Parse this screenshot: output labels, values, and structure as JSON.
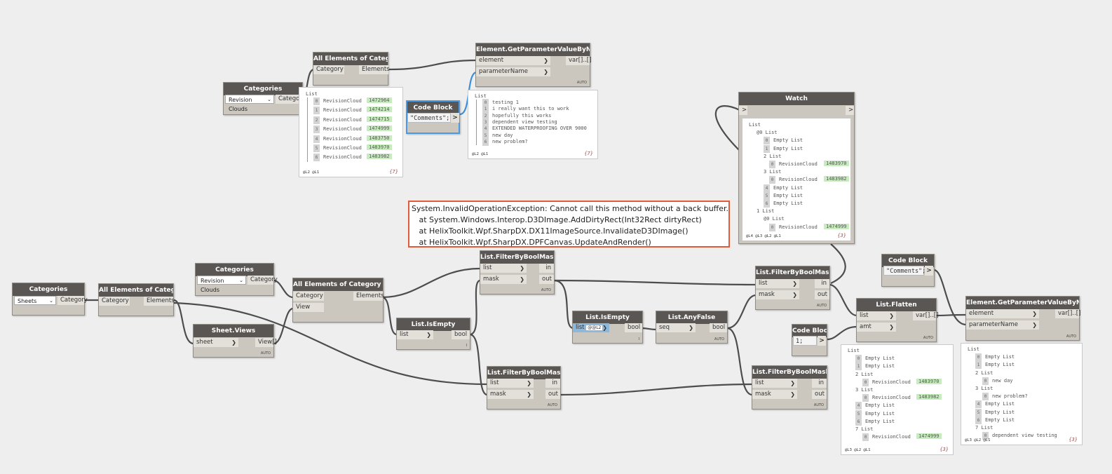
{
  "nodes": {
    "cat_top": {
      "title": "Categories",
      "dropdown": "Revision Clouds",
      "out": "Category"
    },
    "aeoc_top": {
      "title": "All Elements of Category",
      "in": "Category",
      "out": "Elements"
    },
    "codeblock_top": {
      "title": "Code Block",
      "code": "\"Comments\";",
      "arrow": ">"
    },
    "getparam_top": {
      "title": "Element.GetParameterValueByName",
      "in1": "element",
      "in2": "parameterName",
      "out": "var[]..[]",
      "lacing": "AUTO"
    },
    "watch": {
      "title": "Watch",
      "in": ">",
      "out": ">"
    },
    "cat_left": {
      "title": "Categories",
      "dropdown": "Sheets",
      "out": "Category"
    },
    "aeoc_left": {
      "title": "All Elements of Category",
      "in": "Category",
      "out": "Elements"
    },
    "cat_mid": {
      "title": "Categories",
      "dropdown": "Revision Clouds",
      "out": "Category"
    },
    "sheetviews": {
      "title": "Sheet.Views",
      "in": "sheet",
      "out": "View[]",
      "lacing": "AUTO"
    },
    "aeociv": {
      "title": "All Elements of Category in View",
      "in1": "Category",
      "in2": "View",
      "out": "Elements"
    },
    "filter1": {
      "title": "List.FilterByBoolMask",
      "in1": "list",
      "in2": "mask",
      "out1": "in",
      "out2": "out",
      "lacing": "AUTO"
    },
    "isempty1": {
      "title": "List.IsEmpty",
      "in": "list",
      "out": "bool",
      "lacing": "I"
    },
    "filter2": {
      "title": "List.FilterByBoolMask",
      "in1": "list",
      "in2": "mask",
      "out1": "in",
      "out2": "out",
      "lacing": "AUTO"
    },
    "isempty2": {
      "title": "List.IsEmpty",
      "in": "list",
      "use_levels": "@@L2",
      "out": "bool",
      "lacing": "I"
    },
    "anyfalse": {
      "title": "List.AnyFalse",
      "in": "seq",
      "out": "bool",
      "lacing": "AUTO"
    },
    "filter3": {
      "title": "List.FilterByBoolMask",
      "in1": "list",
      "in2": "mask",
      "out1": "in",
      "out2": "out",
      "lacing": "AUTO"
    },
    "filter4": {
      "title": "List.FilterByBoolMask",
      "in1": "list",
      "in2": "mask",
      "out1": "in",
      "out2": "out",
      "lacing": "AUTO"
    },
    "codeblock_r": {
      "title": "Code Block",
      "code": "\"Comments\";",
      "arrow": ">"
    },
    "codeblock_1": {
      "title": "Code Block",
      "code": "1;",
      "arrow": ">"
    },
    "flatten": {
      "title": "List.Flatten",
      "in1": "list",
      "in2": "amt",
      "out": "var[]..[]",
      "lacing": "AUTO"
    },
    "getparam_r": {
      "title": "Element.GetParameterValueByName",
      "in1": "element",
      "in2": "parameterName",
      "out": "var[]..[]",
      "lacing": "AUTO"
    }
  },
  "previews": {
    "aeoc_top": {
      "header": "List",
      "items": [
        {
          "i": "0",
          "label": "RevisionCloud",
          "value": "1472964"
        },
        {
          "i": "1",
          "label": "RevisionCloud",
          "value": "1474214"
        },
        {
          "i": "2",
          "label": "RevisionCloud",
          "value": "1474715"
        },
        {
          "i": "3",
          "label": "RevisionCloud",
          "value": "1474999"
        },
        {
          "i": "4",
          "label": "RevisionCloud",
          "value": "1483750"
        },
        {
          "i": "5",
          "label": "RevisionCloud",
          "value": "1483970"
        },
        {
          "i": "6",
          "label": "RevisionCloud",
          "value": "1483982"
        }
      ],
      "levels": "@L2 @L1",
      "count": "{7}"
    },
    "getparam_top": {
      "header": "List",
      "items": [
        {
          "i": "0",
          "text": "testing 1"
        },
        {
          "i": "1",
          "text": "i really want this to work"
        },
        {
          "i": "2",
          "text": "hopefully this works"
        },
        {
          "i": "3",
          "text": "dependent view testing"
        },
        {
          "i": "4",
          "text": "EXTENDED WATERPROOFING OVER 9000"
        },
        {
          "i": "5",
          "text": "new day"
        },
        {
          "i": "6",
          "text": "new problem?"
        }
      ],
      "levels": "@L2 @L1",
      "count": "{7}"
    },
    "watch": {
      "rows": [
        {
          "t": "List"
        },
        {
          "t": "@0 List"
        },
        {
          "i": "0",
          "t": "Empty List"
        },
        {
          "i": "1",
          "t": "Empty List"
        },
        {
          "t": "2 List"
        },
        {
          "i": "0",
          "t": "RevisionCloud",
          "v": "1483970"
        },
        {
          "t": "3 List"
        },
        {
          "i": "0",
          "t": "RevisionCloud",
          "v": "1483982"
        },
        {
          "i": "4",
          "t": "Empty List"
        },
        {
          "i": "5",
          "t": "Empty List"
        },
        {
          "i": "6",
          "t": "Empty List"
        },
        {
          "t": "1 List"
        },
        {
          "t": "@0 List"
        },
        {
          "i": "0",
          "t": "RevisionCloud",
          "v": "1474999"
        }
      ],
      "levels": "@L4 @L3 @L2 @L1",
      "count": "{3}"
    },
    "flatten": {
      "rows": [
        {
          "t": "List"
        },
        {
          "i": "0",
          "t": "Empty List"
        },
        {
          "i": "1",
          "t": "Empty List"
        },
        {
          "t": "2 List"
        },
        {
          "i": "0",
          "t": "RevisionCloud",
          "v": "1483970"
        },
        {
          "t": "3 List"
        },
        {
          "i": "0",
          "t": "RevisionCloud",
          "v": "1483982"
        },
        {
          "i": "4",
          "t": "Empty List"
        },
        {
          "i": "5",
          "t": "Empty List"
        },
        {
          "i": "6",
          "t": "Empty List"
        },
        {
          "t": "7 List"
        },
        {
          "i": "0",
          "t": "RevisionCloud",
          "v": "1474999"
        }
      ],
      "levels": "@L3 @L2 @L1",
      "count": "{3}"
    },
    "getparam_r": {
      "rows": [
        {
          "t": "List"
        },
        {
          "i": "0",
          "t": "Empty List"
        },
        {
          "i": "1",
          "t": "Empty List"
        },
        {
          "t": "2 List"
        },
        {
          "i": "0",
          "t": "new day"
        },
        {
          "t": "3 List"
        },
        {
          "i": "0",
          "t": "new problem?"
        },
        {
          "i": "4",
          "t": "Empty List"
        },
        {
          "i": "5",
          "t": "Empty List"
        },
        {
          "i": "6",
          "t": "Empty List"
        },
        {
          "t": "7 List"
        },
        {
          "i": "0",
          "t": "dependent view testing"
        }
      ],
      "levels": "@L3 @L2 @L1",
      "count": "{3}"
    }
  },
  "error": {
    "line1": "System.InvalidOperationException: Cannot call this method without a back buffer.",
    "line2": "   at System.Windows.Interop.D3DImage.AddDirtyRect(Int32Rect dirtyRect)",
    "line3": "   at HelixToolkit.Wpf.SharpDX.DX11ImageSource.InvalidateD3DImage()",
    "line4": "   at HelixToolkit.Wpf.SharpDX.DPFCanvas.UpdateAndRender()"
  }
}
